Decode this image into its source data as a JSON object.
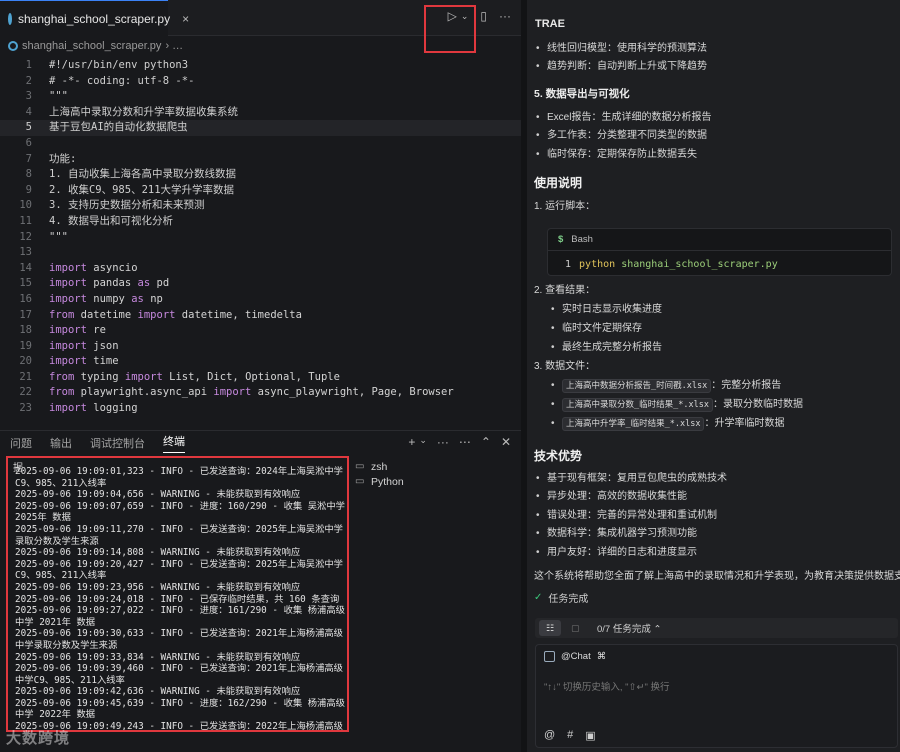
{
  "editor": {
    "tab_label": "shanghai_school_scraper.py",
    "tab_close": "×",
    "breadcrumb_file": "shanghai_school_scraper.py",
    "breadcrumb_more": "› …",
    "lines": [
      {
        "n": "1",
        "t": "#!/usr/bin/env python3"
      },
      {
        "n": "2",
        "t": "# -*- coding: utf-8 -*-"
      },
      {
        "n": "3",
        "t": "\"\"\""
      },
      {
        "n": "4",
        "t": "上海高中录取分数和升学率数据收集系统"
      },
      {
        "n": "5",
        "t": "基于豆包AI的自动化数据爬虫"
      },
      {
        "n": "6",
        "t": ""
      },
      {
        "n": "7",
        "t": "功能:"
      },
      {
        "n": "8",
        "t": "1. 自动收集上海各高中录取分数线数据"
      },
      {
        "n": "9",
        "t": "2. 收集C9、985、211大学升学率数据"
      },
      {
        "n": "10",
        "t": "3. 支持历史数据分析和未来预测"
      },
      {
        "n": "11",
        "t": "4. 数据导出和可视化分析"
      },
      {
        "n": "12",
        "t": "\"\"\""
      },
      {
        "n": "13",
        "t": ""
      },
      {
        "n": "14",
        "t": "import asyncio"
      },
      {
        "n": "15",
        "t": "import pandas as pd"
      },
      {
        "n": "16",
        "t": "import numpy as np"
      },
      {
        "n": "17",
        "t": "from datetime import datetime, timedelta"
      },
      {
        "n": "18",
        "t": "import re"
      },
      {
        "n": "19",
        "t": "import json"
      },
      {
        "n": "20",
        "t": "import time"
      },
      {
        "n": "21",
        "t": "from typing import List, Dict, Optional, Tuple"
      },
      {
        "n": "22",
        "t": "from playwright.async_api import async_playwright, Page, Browser"
      },
      {
        "n": "23",
        "t": "import logging"
      }
    ]
  },
  "panel": {
    "tabs": [
      "问题",
      "输出",
      "调试控制台",
      "终端"
    ],
    "active_tab": "终端",
    "terminal_first_row": "据",
    "terminal_lines": [
      "2025-09-06 19:09:01,323 - INFO - 已发送查询：2024年上海吴淞中学C9、985、211入线率",
      "2025-09-06 19:09:04,656 - WARNING - 未能获取到有效响应",
      "2025-09-06 19:09:07,659 - INFO - 进度：160/290 - 收集 吴淞中学 2025年 数据",
      "2025-09-06 19:09:11,270 - INFO - 已发送查询：2025年上海吴淞中学录取分数及学生来源",
      "2025-09-06 19:09:14,808 - WARNING - 未能获取到有效响应",
      "2025-09-06 19:09:20,427 - INFO - 已发送查询：2025年上海吴淞中学C9、985、211入线率",
      "2025-09-06 19:09:23,956 - WARNING - 未能获取到有效响应",
      "2025-09-06 19:09:24,018 - INFO - 已保存临时结果，共 160 条查询",
      "2025-09-06 19:09:27,022 - INFO - 进度：161/290 - 收集 杨浦高级中学 2021年 数据",
      "2025-09-06 19:09:30,633 - INFO - 已发送查询：2021年上海杨浦高级中学录取分数及学生来源",
      "2025-09-06 19:09:33,834 - WARNING - 未能获取到有效响应",
      "2025-09-06 19:09:39,460 - INFO - 已发送查询：2021年上海杨浦高级中学C9、985、211入线率",
      "2025-09-06 19:09:42,636 - WARNING - 未能获取到有效响应",
      "2025-09-06 19:09:45,639 - INFO - 进度：162/290 - 收集 杨浦高级中学 2022年 数据",
      "2025-09-06 19:09:49,243 - INFO - 已发送查询：2022年上海杨浦高级中"
    ],
    "terminal_list": [
      "zsh",
      "Python"
    ],
    "watermark": "大数跨境"
  },
  "chat": {
    "title": "TRAE",
    "bullets_top": [
      {
        "label": "线性回归模型",
        "text": "：使用科学的预测算法"
      },
      {
        "label": "趋势判断",
        "text": "：自动判断上升或下降趋势"
      }
    ],
    "section5": "5. 数据导出与可视化",
    "bullets_export": [
      {
        "label": "Excel报告",
        "text": "：生成详细的数据分析报告"
      },
      {
        "label": "多工作表",
        "text": "：分类整理不同类型的数据"
      },
      {
        "label": "临时保存",
        "text": "：定期保存防止数据丢失"
      }
    ],
    "usage_heading": "使用说明",
    "step1": "1. 运行脚本：",
    "bash_label": "Bash",
    "bash_line_no": "1",
    "bash_cmd": "python",
    "bash_arg": "shanghai_school_scraper.py",
    "step2": "2. 查看结果：",
    "step2_items": [
      "实时日志显示收集进度",
      "临时文件定期保存",
      "最终生成完整分析报告"
    ],
    "step3": "3. 数据文件：",
    "files": [
      {
        "code": "上海高中数据分析报告_时间戳.xlsx",
        "text": "：完整分析报告"
      },
      {
        "code": "上海高中录取分数_临时结果_*.xlsx",
        "text": "：录取分数临时数据"
      },
      {
        "code": "上海高中升学率_临时结果_*.xlsx",
        "text": "：升学率临时数据"
      }
    ],
    "tech_heading": "技术优势",
    "tech": [
      {
        "label": "基于现有框架",
        "text": "：复用豆包爬虫的成熟技术"
      },
      {
        "label": "异步处理",
        "text": "：高效的数据收集性能"
      },
      {
        "label": "错误处理",
        "text": "：完善的异常处理和重试机制"
      },
      {
        "label": "数据科学",
        "text": "：集成机器学习预测功能"
      },
      {
        "label": "用户友好",
        "text": "：详细的日志和进度显示"
      }
    ],
    "summary": "这个系统将帮助您全面了解上海高中的录取情况和升学表现，为教育决策提供数据支持。",
    "done_label": "任务完成",
    "task_progress": "0/7 任务完成 ⌃",
    "chat_tag": "@Chat",
    "input_placeholder": "\"↑↓\" 切换历史输入, \"⇧↵\" 换行"
  },
  "colors": {
    "highlight_red": "#e0383e",
    "accent_blue": "#3b82f6",
    "success_green": "#3ac77a"
  },
  "icons": [
    "python-file-icon",
    "run-icon",
    "split-editor-icon",
    "more-icon",
    "plus-icon",
    "chevron-up-icon",
    "close-icon",
    "check-icon",
    "terminal-icon",
    "at-icon",
    "hash-icon",
    "image-icon"
  ]
}
